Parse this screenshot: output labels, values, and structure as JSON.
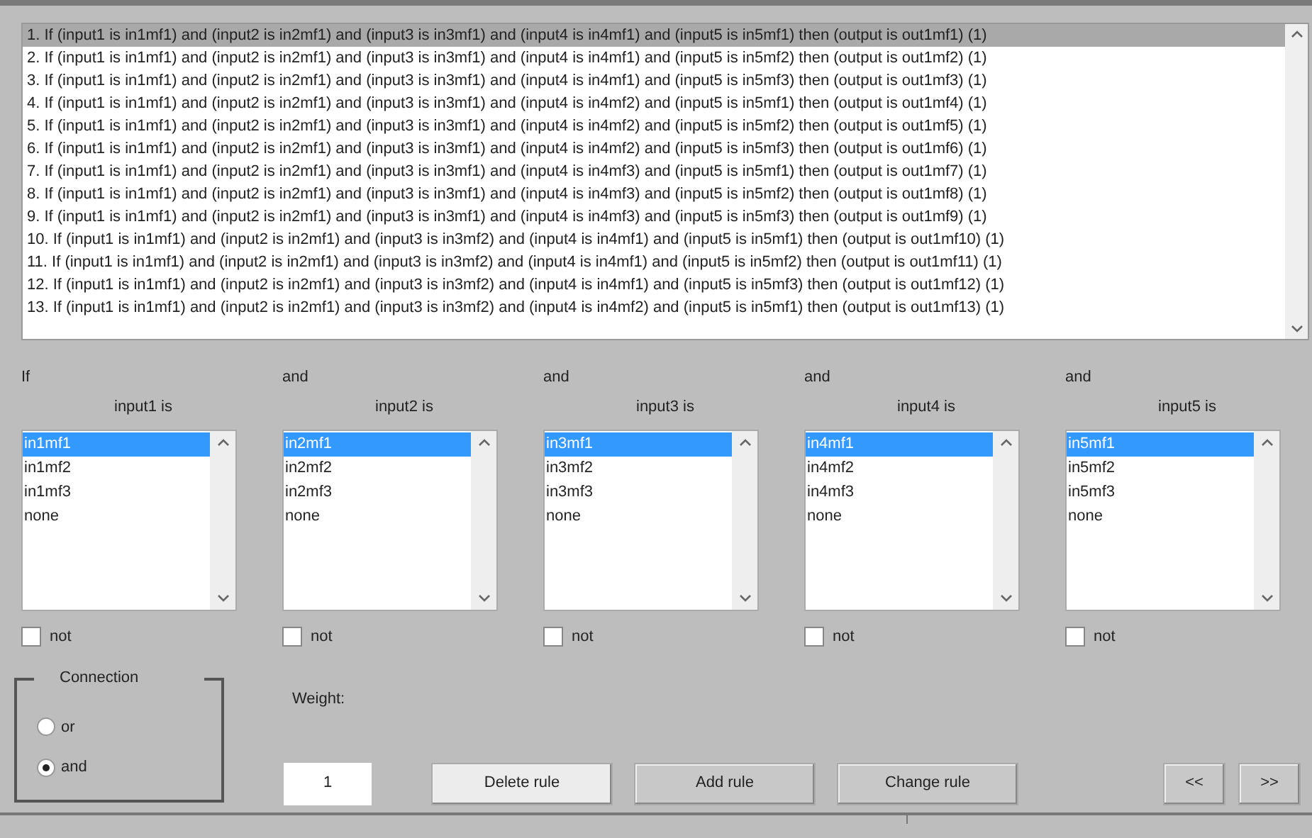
{
  "rules": [
    {
      "text": "1. If (input1 is in1mf1) and (input2 is in2mf1) and (input3 is in3mf1) and (input4 is in4mf1) and (input5 is in5mf1) then (output is out1mf1) (1)",
      "selected": true
    },
    {
      "text": "2. If (input1 is in1mf1) and (input2 is in2mf1) and (input3 is in3mf1) and (input4 is in4mf1) and (input5 is in5mf2) then (output is out1mf2) (1)",
      "selected": false
    },
    {
      "text": "3. If (input1 is in1mf1) and (input2 is in2mf1) and (input3 is in3mf1) and (input4 is in4mf1) and (input5 is in5mf3) then (output is out1mf3) (1)",
      "selected": false
    },
    {
      "text": "4. If (input1 is in1mf1) and (input2 is in2mf1) and (input3 is in3mf1) and (input4 is in4mf2) and (input5 is in5mf1) then (output is out1mf4) (1)",
      "selected": false
    },
    {
      "text": "5. If (input1 is in1mf1) and (input2 is in2mf1) and (input3 is in3mf1) and (input4 is in4mf2) and (input5 is in5mf2) then (output is out1mf5) (1)",
      "selected": false
    },
    {
      "text": "6. If (input1 is in1mf1) and (input2 is in2mf1) and (input3 is in3mf1) and (input4 is in4mf2) and (input5 is in5mf3) then (output is out1mf6) (1)",
      "selected": false
    },
    {
      "text": "7. If (input1 is in1mf1) and (input2 is in2mf1) and (input3 is in3mf1) and (input4 is in4mf3) and (input5 is in5mf1) then (output is out1mf7) (1)",
      "selected": false
    },
    {
      "text": "8. If (input1 is in1mf1) and (input2 is in2mf1) and (input3 is in3mf1) and (input4 is in4mf3) and (input5 is in5mf2) then (output is out1mf8) (1)",
      "selected": false
    },
    {
      "text": "9. If (input1 is in1mf1) and (input2 is in2mf1) and (input3 is in3mf1) and (input4 is in4mf3) and (input5 is in5mf3) then (output is out1mf9) (1)",
      "selected": false
    },
    {
      "text": "10. If (input1 is in1mf1) and (input2 is in2mf1) and (input3 is in3mf2) and (input4 is in4mf1) and (input5 is in5mf1) then (output is out1mf10) (1)",
      "selected": false
    },
    {
      "text": "11. If (input1 is in1mf1) and (input2 is in2mf1) and (input3 is in3mf2) and (input4 is in4mf1) and (input5 is in5mf2) then (output is out1mf11) (1)",
      "selected": false
    },
    {
      "text": "12. If (input1 is in1mf1) and (input2 is in2mf1) and (input3 is in3mf2) and (input4 is in4mf1) and (input5 is in5mf3) then (output is out1mf12) (1)",
      "selected": false
    },
    {
      "text": "13. If (input1 is in1mf1) and (input2 is in2mf1) and (input3 is in3mf2) and (input4 is in4mf2) and (input5 is in5mf1) then (output is out1mf13) (1)",
      "selected": false
    }
  ],
  "antecedents": [
    {
      "connector": "If",
      "label": "input1 is",
      "options": [
        {
          "label": "in1mf1",
          "selected": true
        },
        {
          "label": "in1mf2",
          "selected": false
        },
        {
          "label": "in1mf3",
          "selected": false
        },
        {
          "label": "none",
          "selected": false
        }
      ],
      "not": {
        "label": "not",
        "checked": false
      }
    },
    {
      "connector": "and",
      "label": "input2 is",
      "options": [
        {
          "label": "in2mf1",
          "selected": true
        },
        {
          "label": "in2mf2",
          "selected": false
        },
        {
          "label": "in2mf3",
          "selected": false
        },
        {
          "label": "none",
          "selected": false
        }
      ],
      "not": {
        "label": "not",
        "checked": false
      }
    },
    {
      "connector": "and",
      "label": "input3 is",
      "options": [
        {
          "label": "in3mf1",
          "selected": true
        },
        {
          "label": "in3mf2",
          "selected": false
        },
        {
          "label": "in3mf3",
          "selected": false
        },
        {
          "label": "none",
          "selected": false
        }
      ],
      "not": {
        "label": "not",
        "checked": false
      }
    },
    {
      "connector": "and",
      "label": "input4 is",
      "options": [
        {
          "label": "in4mf1",
          "selected": true
        },
        {
          "label": "in4mf2",
          "selected": false
        },
        {
          "label": "in4mf3",
          "selected": false
        },
        {
          "label": "none",
          "selected": false
        }
      ],
      "not": {
        "label": "not",
        "checked": false
      }
    },
    {
      "connector": "and",
      "label": "input5 is",
      "options": [
        {
          "label": "in5mf1",
          "selected": true
        },
        {
          "label": "in5mf2",
          "selected": false
        },
        {
          "label": "in5mf3",
          "selected": false
        },
        {
          "label": "none",
          "selected": false
        }
      ],
      "not": {
        "label": "not",
        "checked": false
      }
    }
  ],
  "connection": {
    "title": "Connection",
    "options": [
      {
        "label": "or",
        "selected": false
      },
      {
        "label": "and",
        "selected": true
      }
    ]
  },
  "weight": {
    "label": "Weight:",
    "value": "1"
  },
  "buttons": [
    {
      "label": "Delete rule",
      "focused": true
    },
    {
      "label": "Add rule",
      "focused": false
    },
    {
      "label": "Change rule",
      "focused": false
    }
  ],
  "nav_buttons": [
    {
      "label": "<<"
    },
    {
      "label": ">>"
    }
  ]
}
